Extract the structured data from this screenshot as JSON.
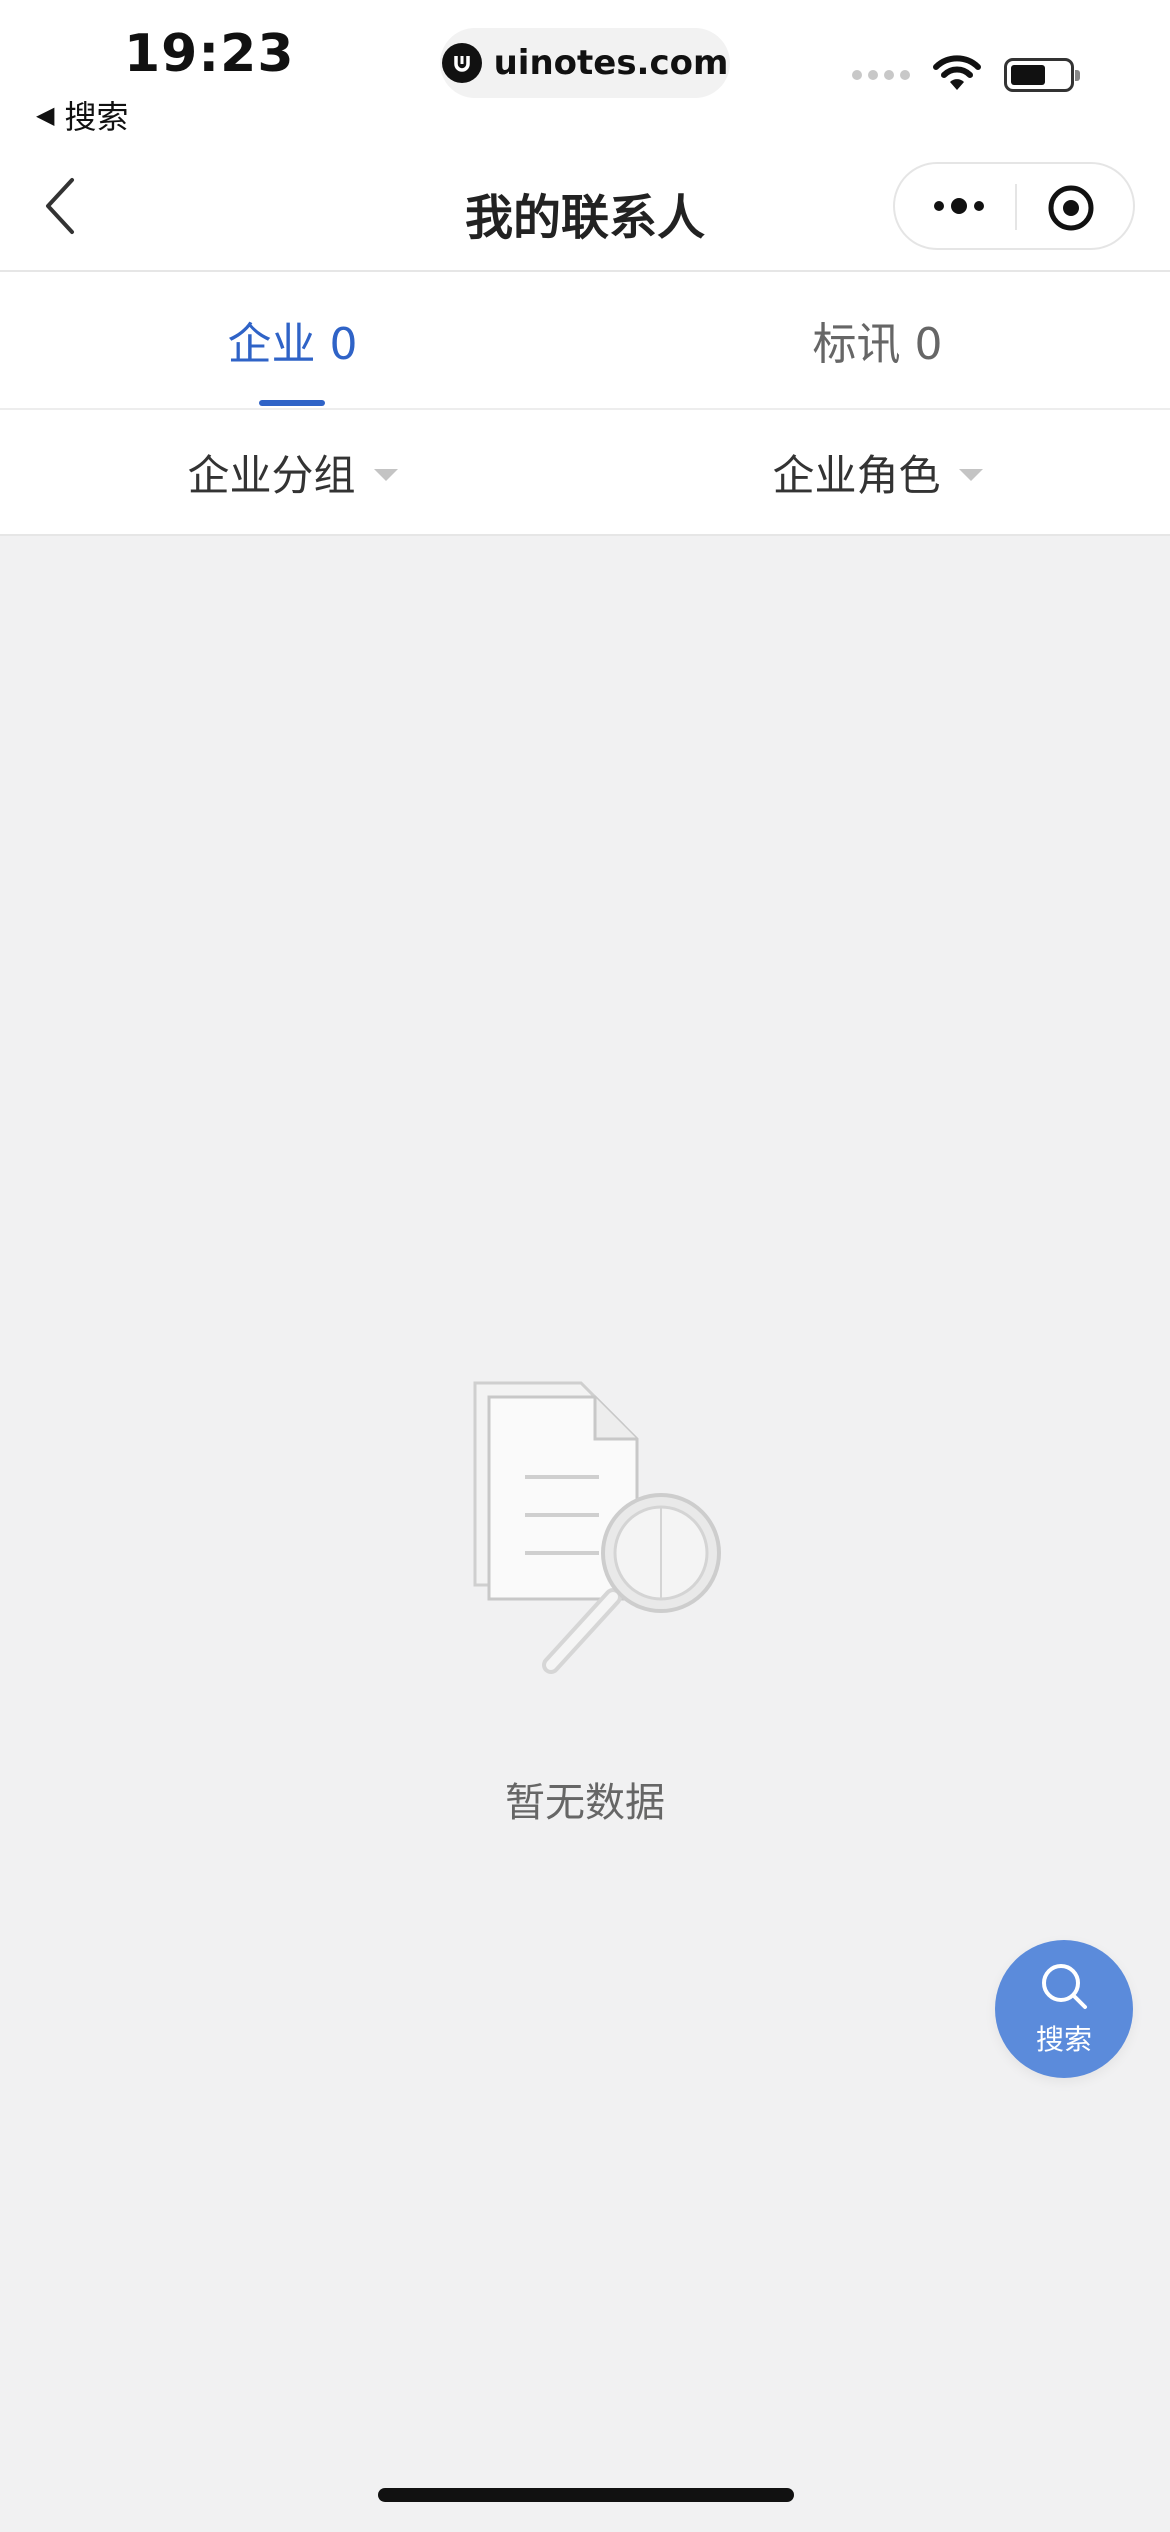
{
  "status_bar": {
    "time": "19:23",
    "back_app_label": "搜索",
    "url": "uinotes.com"
  },
  "nav": {
    "title": "我的联系人",
    "back_icon": "chevron-left-icon",
    "more_icon": "more-dots-icon",
    "close_icon": "target-icon"
  },
  "tabs": [
    {
      "label": "企业 0",
      "active": true
    },
    {
      "label": "标讯 0",
      "active": false
    }
  ],
  "filters": [
    {
      "label": "企业分组"
    },
    {
      "label": "企业角色"
    }
  ],
  "empty_state": {
    "illustration": "document-search-icon",
    "text": "暂无数据"
  },
  "fab": {
    "icon": "search-icon",
    "label": "搜索"
  },
  "colors": {
    "accent": "#2f63c7",
    "fab": "#5b8bdb",
    "background": "#f1f1f2"
  }
}
